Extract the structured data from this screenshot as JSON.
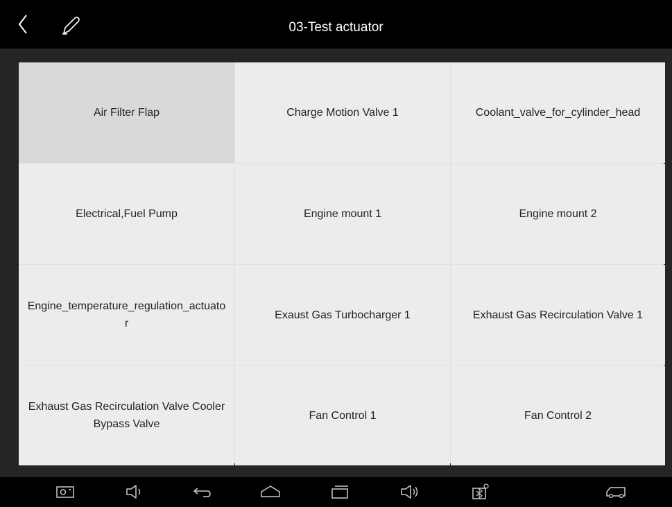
{
  "header": {
    "title": "03-Test actuator",
    "back_icon": "chevron-left-icon",
    "edit_icon": "pencil-icon"
  },
  "grid": {
    "selected_index": 0,
    "items": [
      {
        "label": "Air Filter Flap"
      },
      {
        "label": "Charge Motion Valve 1"
      },
      {
        "label": "Coolant_valve_for_cylinder_head"
      },
      {
        "label": "Electrical,Fuel Pump"
      },
      {
        "label": "Engine mount 1"
      },
      {
        "label": "Engine mount 2"
      },
      {
        "label": "Engine_temperature_regulation_actuator"
      },
      {
        "label": "Exaust Gas Turbocharger 1"
      },
      {
        "label": "Exhaust Gas Recirculation Valve 1"
      },
      {
        "label": "Exhaust Gas Recirculation Valve Cooler Bypass Valve"
      },
      {
        "label": "Fan Control 1"
      },
      {
        "label": "Fan Control 2"
      }
    ]
  },
  "navbar": {
    "icons": [
      "screenshot-icon",
      "volume-down-icon",
      "back-arrow-icon",
      "home-icon",
      "recent-apps-icon",
      "volume-up-icon",
      "bluetooth-adapter-icon",
      "vehicle-icon"
    ]
  },
  "colors": {
    "header_bg": "#000000",
    "body_bg": "#252525",
    "cell_bg": "#ececec",
    "cell_selected_bg": "#d9d9d9",
    "text": "#222222"
  }
}
